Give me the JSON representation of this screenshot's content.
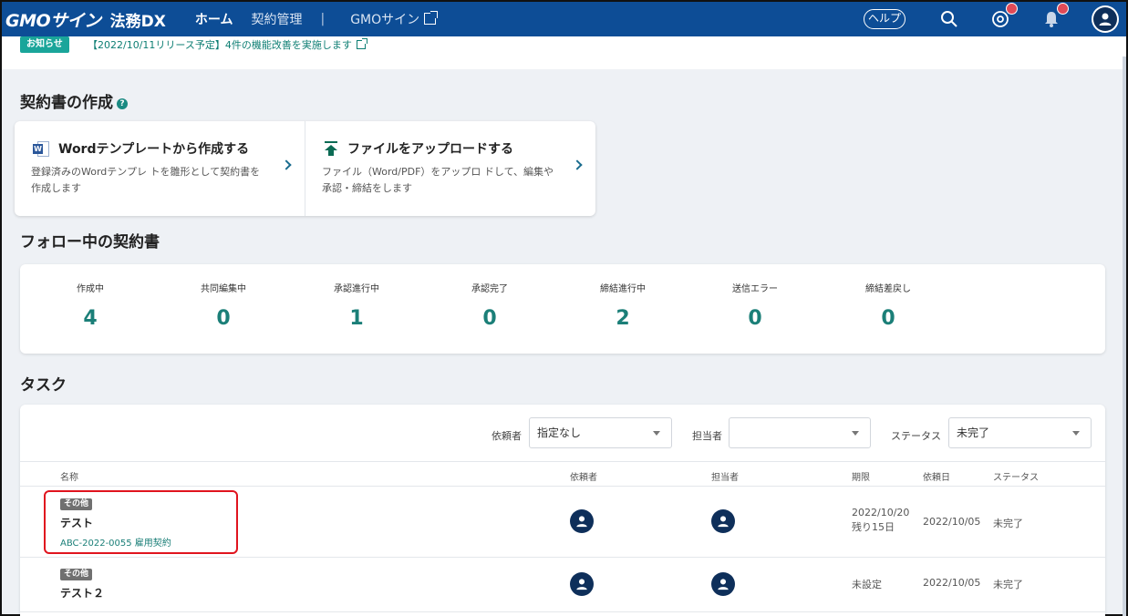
{
  "header": {
    "logo": "GMOサイン",
    "logo_sub": "法務DX",
    "nav": {
      "home": "ホーム",
      "contracts": "契約管理",
      "separator": "|",
      "gmo_sign": "GMOサイン"
    },
    "help_label": "ヘルプ"
  },
  "notice": {
    "tag": "お知らせ",
    "text": "【2022/10/11リリース予定】4件の機能改善を実施します"
  },
  "create_section": {
    "title": "契約書の作成",
    "word": {
      "title": "Wordテンプレートから作成する",
      "desc": "登録済みのWordテンプレ トを雛形として契約書を作成します"
    },
    "upload": {
      "title": "ファイルをアップロードする",
      "desc": "ファイル（Word/PDF）をアップロ ドして、編集や承認・締結をします"
    }
  },
  "follow_section": {
    "title": "フォロー中の契約書",
    "stats": [
      {
        "label": "作成中",
        "value": "4"
      },
      {
        "label": "共同編集中",
        "value": "0"
      },
      {
        "label": "承認進行中",
        "value": "1"
      },
      {
        "label": "承認完了",
        "value": "0"
      },
      {
        "label": "締結進行中",
        "value": "2"
      },
      {
        "label": "送信エラー",
        "value": "0"
      },
      {
        "label": "締結差戻し",
        "value": "0"
      }
    ]
  },
  "tasks_section": {
    "title": "タスク",
    "filters": {
      "requester_label": "依頼者",
      "requester_value": "指定なし",
      "assignee_label": "担当者",
      "assignee_value": "",
      "status_label": "ステータス",
      "status_value": "未完了"
    },
    "columns": {
      "name": "名称",
      "requester": "依頼者",
      "assignee": "担当者",
      "due": "期限",
      "requested_date": "依頼日",
      "status": "ステータス"
    },
    "rows": [
      {
        "tag": "その他",
        "name": "テスト",
        "id": "ABC-2022-0055 雇用契約",
        "due": "2022/10/20",
        "due_remaining": "残り15日",
        "requested_date": "2022/10/05",
        "status": "未完了"
      },
      {
        "tag": "その他",
        "name": "テスト２",
        "due": "未設定",
        "requested_date": "2022/10/05",
        "status": "未完了"
      }
    ]
  },
  "colors": {
    "header_bg": "#0d4d96",
    "accent_teal": "#1b7f78",
    "notification_badge": "#e04a57",
    "highlight_border": "#e0141e"
  }
}
